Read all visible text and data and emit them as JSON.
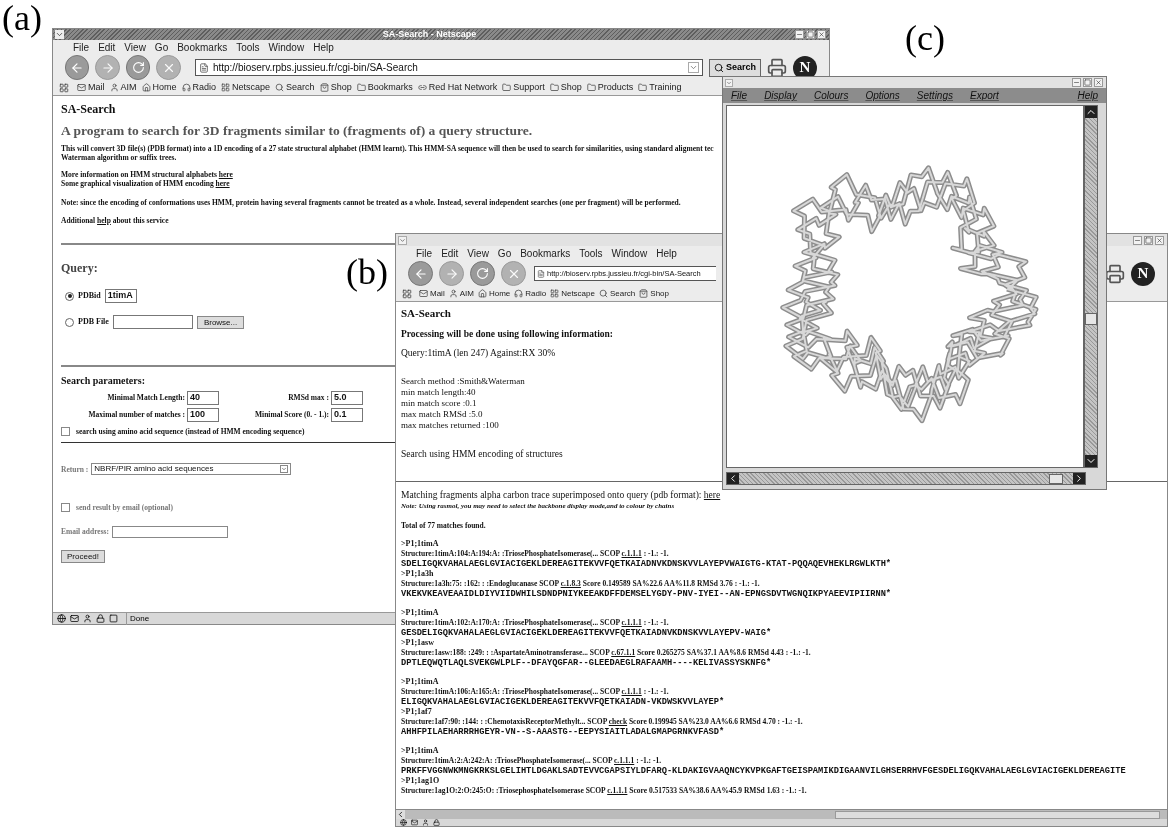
{
  "figure_labels": [
    "(a)",
    "(b)",
    "(c)"
  ],
  "window_a": {
    "title": "SA-Search - Netscape",
    "menu": [
      "File",
      "Edit",
      "View",
      "Go",
      "Bookmarks",
      "Tools",
      "Window",
      "Help"
    ],
    "url": "http://bioserv.rpbs.jussieu.fr/cgi-bin/SA-Search",
    "search_button": "Search",
    "logo_text": "N",
    "bookmarks": [
      {
        "label": "Mail",
        "kind": "mail"
      },
      {
        "label": "AIM",
        "kind": "person"
      },
      {
        "label": "Home",
        "kind": "home"
      },
      {
        "label": "Radio",
        "kind": "radio"
      },
      {
        "label": "Netscape",
        "kind": "badge"
      },
      {
        "label": "Search",
        "kind": "search"
      },
      {
        "label": "Shop",
        "kind": "shop"
      },
      {
        "label": "Bookmarks",
        "kind": "folder"
      },
      {
        "label": "Red Hat Network",
        "kind": "link"
      },
      {
        "label": "Support",
        "kind": "folder"
      },
      {
        "label": "Shop",
        "kind": "folder"
      },
      {
        "label": "Products",
        "kind": "folder"
      },
      {
        "label": "Training",
        "kind": "folder"
      }
    ],
    "page": {
      "heading": "SA-Search",
      "tagline": "A program to search for 3D fragments similar to (fragments of) a query structure.",
      "description": [
        "This will convert 3D file(s) (PDB format) into a 1D encoding of a 27 state structural alphabet (HMM learnt). This HMM-SA sequence will then be used to search for similarities, using standard aligment tec",
        "Waterman algorithm or suffix trees."
      ],
      "info_lines": [
        {
          "text": "More information on HMM structural alphabets",
          "link": "here"
        },
        {
          "text": "Some graphical visualization of HMM encoding",
          "link": "here"
        }
      ],
      "note": "Note: since the encoding of conformations uses HMM, protein having several fragments cannot be treated as a whole. Instead, several independent searches (one per fragment) will be performed.",
      "help_line": {
        "before": "Additional",
        "link": "help",
        "after": "about this service"
      },
      "query": {
        "title": "Query:",
        "options": [
          {
            "label": "PDBid",
            "selected": true,
            "kind": "text",
            "value": "1timA"
          },
          {
            "label": "PDB File",
            "selected": false,
            "kind": "file",
            "button": "Browse..."
          }
        ]
      },
      "params": {
        "title": "Search parameters:",
        "fields": [
          {
            "label": "Minimal Match Length:",
            "value": "40"
          },
          {
            "label": "RMSd max :",
            "value": "5.0"
          },
          {
            "label": "Maximal number of matches :",
            "value": "100"
          },
          {
            "label": "Minimal Score (0. - 1.):",
            "value": "0.1"
          }
        ],
        "checkbox": {
          "label": "search using amino acid sequence (instead of HMM encoding sequence)",
          "checked": false
        }
      },
      "return": {
        "label": "Return :",
        "value": "NBRF/PIR amino acid sequences"
      },
      "email": {
        "checkbox": {
          "label": "send result by email (optional)",
          "checked": false
        },
        "label": "Email address:"
      },
      "proceed": "Proceed!"
    },
    "status": "Done"
  },
  "window_b": {
    "menu": [
      "File",
      "Edit",
      "View",
      "Go",
      "Bookmarks",
      "Tools",
      "Window",
      "Help"
    ],
    "url": "http://bioserv.rpbs.jussieu.fr/cgi-bin/SA-Search",
    "logo_text": "N",
    "bookmarks": [
      {
        "label": "Mail",
        "kind": "mail"
      },
      {
        "label": "AIM",
        "kind": "person"
      },
      {
        "label": "Home",
        "kind": "home"
      },
      {
        "label": "Radio",
        "kind": "radio"
      },
      {
        "label": "Netscape",
        "kind": "badge"
      },
      {
        "label": "Search",
        "kind": "search"
      },
      {
        "label": "Shop",
        "kind": "shop"
      }
    ],
    "page": {
      "heading": "SA-Search",
      "processing": "Processing will be done using following information:",
      "query_line": "Query:1timA (len 247) Against:RX 30%",
      "settings": [
        "Search method :Smith&Waterman",
        "min match length:40",
        "min match score :0.1",
        "max match RMSd :5.0",
        "max matches returned :100"
      ],
      "method_line": "Search using HMM encoding of structures",
      "matching": {
        "text": "Matching fragments alpha carbon trace superimposed onto query (pdb format):",
        "link": "here"
      },
      "note": "Note: Using rasmol, you may need to select the backbone display mode,and to colour by chains",
      "total": "Total of 77 matches found.",
      "groups": [
        {
          "entries": [
            {
              "header": ">P1;1timA",
              "structure": "Structure:1timA:104:A:194:A: :TriosePhosphateIsomerase(... SCOP",
              "scop": "c.1.1.1",
              "details": ": -1.: -1.",
              "sequence": "SDELIGQKVAHALAEGLGVIACIGEKLDEREAGITEKVVFQETKAIADNVKDNSKVVLAYEPVWAIGTG-KTAT-PQQAQEVHEKLRGWLKTH*"
            },
            {
              "header": ">P1;1a3h",
              "structure": "Structure:1a3h:75: :162: : :Endoglucanase SCOP",
              "scop": "c.1.8.3",
              "details": "Score 0.149589 SA%22.6 AA%11.8 RMSd 3.76 : -1.: -1.",
              "sequence": "VKEKVKEAVEAAIDLDIYVIIDWHILSDNDPNIYKEEAKDFFDEMSELYGDY-PNV-IYEI--AN-EPNGSDVTWGNQIKPYAEEVIPIIRNN*"
            }
          ]
        },
        {
          "entries": [
            {
              "header": ">P1;1timA",
              "structure": "Structure:1timA:102:A:170:A: :TriosePhosphateIsomerase(... SCOP",
              "scop": "c.1.1.1",
              "details": ": -1.: -1.",
              "sequence": "GESDELIGQKVAHALAEGLGVIACIGEKLDEREAGITEKVVFQETKAIADNVKDNSKVVLAYEPV-WAIG*"
            },
            {
              "header": ">P1;1asw",
              "structure": "Structure:1asw:188: :249: : :AspartateAminotransferase... SCOP",
              "scop": "c.67.1.1",
              "details": "Score 0.265275 SA%37.1 AA%8.6 RMSd 4.43 : -1.: -1.",
              "sequence": "DPTLEQWQTLAQLSVEKGWLPLF--DFAYQGFAR--GLEEDAEGLRAFAAMH----KELIVASSYSKNFG*"
            }
          ]
        },
        {
          "entries": [
            {
              "header": ">P1;1timA",
              "structure": "Structure:1timA:106:A:165:A: :TriosePhosphateIsomerase(... SCOP",
              "scop": "c.1.1.1",
              "details": ": -1.: -1.",
              "sequence": "ELIGQKVAHALAEGLGVIACIGEKLDEREAGITEKVVFQETKAIADN-VKDWSKVVLAYEP*"
            },
            {
              "header": ">P1;1af7",
              "structure": "Structure:1af7:90: :144: : :ChemotaxisReceptorMethylt... SCOP",
              "scop": "check",
              "details": "Score 0.199945 SA%23.0 AA%6.6 RMSd 4.70 : -1.: -1.",
              "sequence": "AHHFPILAEHARRRHGEYR-VN--S-AAASTG--EEPYSIAITLADALGMAPGRNKVFASD*"
            }
          ]
        },
        {
          "entries": [
            {
              "header": ">P1;1timA",
              "structure": "Structure:1timA:2:A:242:A: :TriosePhosphateIsomerase(... SCOP",
              "scop": "c.1.1.1",
              "details": ": -1.: -1.",
              "sequence": "PRKFFVGGNWKMNGKRKSLGELIHTLDGAKLSADTEVVCGAPSIYLDFARQ-KLDAKIGVAAQNCYKVPKGAFTGEISPAMIKDIGAANVILGHSERRHVFGESDELIGQKVAHALAEGLGVIACIGEKLDEREAGITE"
            },
            {
              "header": ">P1;1ag1O",
              "structure": "Structure:1ag1O:2:O:245:O: :TriosephosphateIsomerase SCOP",
              "scop": "c.1.1.1",
              "details": "Score 0.517533 SA%38.6 AA%45.9 RMSd 1.63 : -1.: -1."
            }
          ]
        }
      ]
    }
  },
  "window_c": {
    "menu": [
      "File",
      "Display",
      "Colours",
      "Options",
      "Settings",
      "Export",
      "Help"
    ]
  }
}
